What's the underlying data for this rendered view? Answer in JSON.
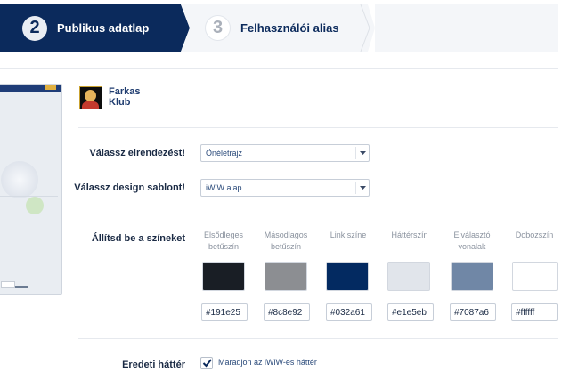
{
  "wizard": {
    "steps": [
      {
        "number": "2",
        "label": "Publikus adatlap",
        "state": "active"
      },
      {
        "number": "3",
        "label": "Felhasználói alias",
        "state": "inactive"
      }
    ]
  },
  "profile": {
    "name_line1": "Farkas",
    "name_line2": "Klub"
  },
  "layout_field": {
    "label": "Válassz elrendezést!",
    "value": "Önéletrajz"
  },
  "template_field": {
    "label": "Válassz design sablont!",
    "value": "iWiW alap"
  },
  "colors": {
    "label": "Állítsd be a színeket",
    "items": [
      {
        "title_line1": "Elsődleges",
        "title_line2": "betűszín",
        "hex": "#191e25",
        "swatch": "#191e25"
      },
      {
        "title_line1": "Másodlagos",
        "title_line2": "betűszín",
        "hex": "#8c8e92",
        "swatch": "#8c8e92"
      },
      {
        "title_line1": "Link színe",
        "title_line2": "",
        "hex": "#032a61",
        "swatch": "#032a61"
      },
      {
        "title_line1": "Háttérszín",
        "title_line2": "",
        "hex": "#e1e5eb",
        "swatch": "#e1e5eb"
      },
      {
        "title_line1": "Elválasztó",
        "title_line2": "vonalak",
        "hex": "#7087a6",
        "swatch": "#7087a6"
      },
      {
        "title_line1": "Dobozszín",
        "title_line2": "",
        "hex": "#ffffff",
        "swatch": "#ffffff"
      }
    ]
  },
  "background": {
    "label": "Eredeti háttér",
    "checkbox_label": "Maradjon az iWiW-es háttér",
    "checked": true
  },
  "theme": {
    "active_step_color": "#0b2a5c",
    "inactive_step_color": "#f4f6f9"
  }
}
